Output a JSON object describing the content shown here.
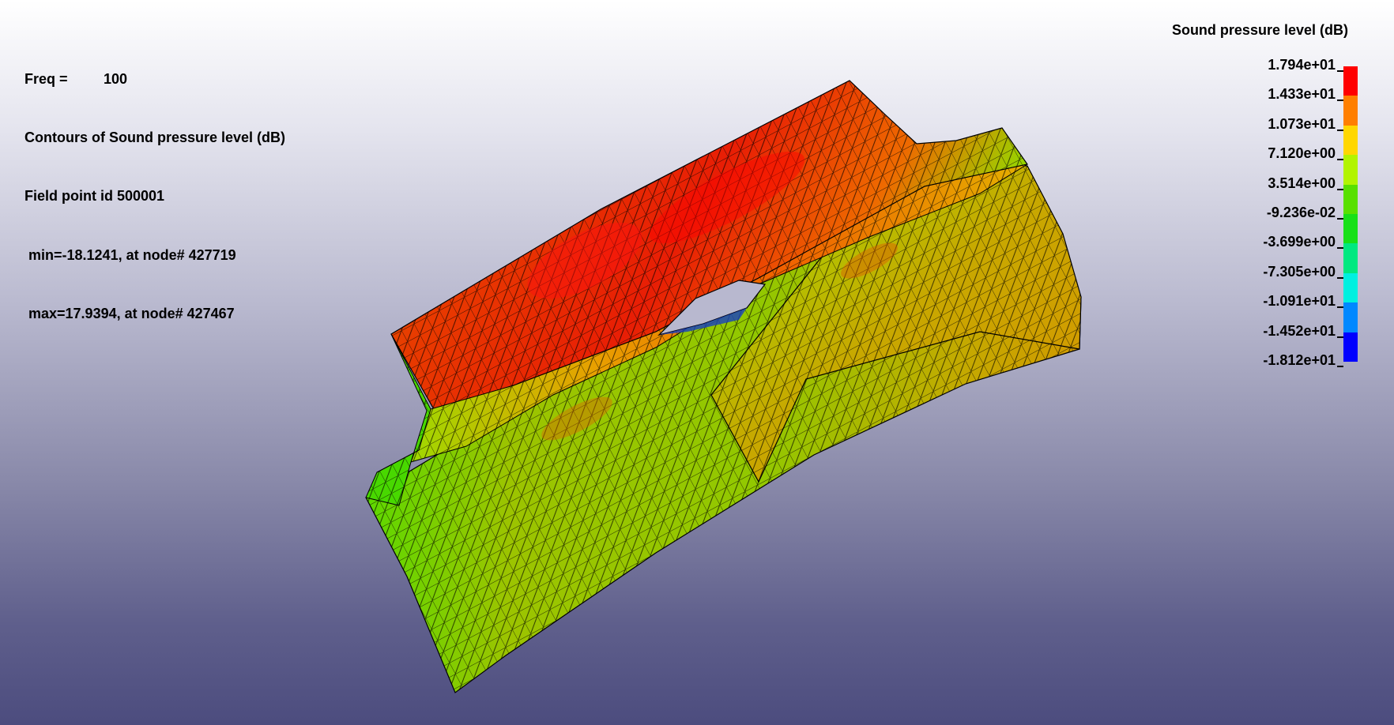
{
  "info": {
    "freq_label": "Freq =",
    "freq_value": "100",
    "contours": "Contours of Sound pressure level (dB)",
    "field_point": "Field point id 500001",
    "min": " min=-18.1241, at node# 427719",
    "max": " max=17.9394, at node# 427467"
  },
  "legend": {
    "title": "Sound pressure level (dB)",
    "ticks": [
      "1.794e+01",
      "1.433e+01",
      "1.073e+01",
      "7.120e+00",
      "3.514e+00",
      "-9.236e-02",
      "-3.699e+00",
      "-7.305e+00",
      "-1.091e+01",
      "-1.452e+01",
      "-1.812e+01"
    ],
    "colors": [
      "#ff0000",
      "#ff7f00",
      "#ffd700",
      "#b2f400",
      "#58e000",
      "#18e018",
      "#00e880",
      "#00f0e0",
      "#0088ff",
      "#0000ff"
    ]
  },
  "model": {
    "color_low": "#3ce000",
    "color_mid": "#b8b400",
    "color_high": "#f01010",
    "hole_color": "#1840c0"
  }
}
